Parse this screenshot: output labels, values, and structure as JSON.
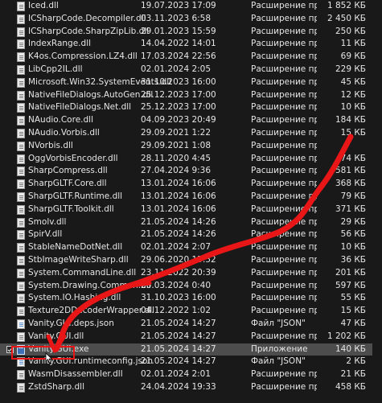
{
  "files": [
    {
      "name": "Iced.dll",
      "date": "19.07.2023 17:09",
      "type": "Расширение при...",
      "size": "1 852 КБ",
      "icon": "dll"
    },
    {
      "name": "ICSharpCode.Decompiler.dll",
      "date": "03.11.2023 6:58",
      "type": "Расширение при...",
      "size": "2 450 КБ",
      "icon": "dll"
    },
    {
      "name": "ICSharpCode.SharpZipLib.dll",
      "date": "29.01.2023 15:59",
      "type": "Расширение при...",
      "size": "250 КБ",
      "icon": "dll"
    },
    {
      "name": "IndexRange.dll",
      "date": "14.04.2022 14:01",
      "type": "Расширение при...",
      "size": "11 КБ",
      "icon": "dll"
    },
    {
      "name": "K4os.Compression.LZ4.dll",
      "date": "17.03.2024 22:56",
      "type": "Расширение при...",
      "size": "69 КБ",
      "icon": "dll"
    },
    {
      "name": "LibCpp2IL.dll",
      "date": "02.01.2024 2:05",
      "type": "Расширение при...",
      "size": "229 КБ",
      "icon": "dll"
    },
    {
      "name": "Microsoft.Win32.SystemEvents.dll",
      "date": "31.10.2023 16:00",
      "type": "Расширение при...",
      "size": "45 КБ",
      "icon": "dll"
    },
    {
      "name": "NativeFileDialogs.AutoGen.dll",
      "date": "25.12.2023 17:00",
      "type": "Расширение при...",
      "size": "12 КБ",
      "icon": "dll"
    },
    {
      "name": "NativeFileDialogs.Net.dll",
      "date": "25.12.2023 17:00",
      "type": "Расширение при...",
      "size": "10 КБ",
      "icon": "dll"
    },
    {
      "name": "NAudio.Core.dll",
      "date": "04.09.2023 20:49",
      "type": "Расширение при...",
      "size": "184 КБ",
      "icon": "dll"
    },
    {
      "name": "NAudio.Vorbis.dll",
      "date": "29.09.2021 1:22",
      "type": "Расширение при...",
      "size": "15 КБ",
      "icon": "dll"
    },
    {
      "name": "NVorbis.dll",
      "date": "29.09.2021 1:08",
      "type": "Расширение при...",
      "size": "",
      "icon": "dll"
    },
    {
      "name": "OggVorbisEncoder.dll",
      "date": "28.11.2020 4:45",
      "type": "Расширение при...",
      "size": "74 КБ",
      "icon": "dll"
    },
    {
      "name": "SharpCompress.dll",
      "date": "27.04.2024 9:36",
      "type": "Расширение при...",
      "size": "581 КБ",
      "icon": "dll"
    },
    {
      "name": "SharpGLTF.Core.dll",
      "date": "13.01.2024 16:06",
      "type": "Расширение при...",
      "size": "368 КБ",
      "icon": "dll"
    },
    {
      "name": "SharpGLTF.Runtime.dll",
      "date": "13.01.2024 16:06",
      "type": "Расширение при...",
      "size": "79 КБ",
      "icon": "dll"
    },
    {
      "name": "SharpGLTF.Toolkit.dll",
      "date": "13.01.2024 16:06",
      "type": "Расширение при...",
      "size": "371 КБ",
      "icon": "dll"
    },
    {
      "name": "Smolv.dll",
      "date": "21.05.2024 14:26",
      "type": "Расширение при...",
      "size": "29 КБ",
      "icon": "dll"
    },
    {
      "name": "SpirV.dll",
      "date": "21.05.2024 14:26",
      "type": "Расширение при...",
      "size": "56 КБ",
      "icon": "dll"
    },
    {
      "name": "StableNameDotNet.dll",
      "date": "02.01.2024 2:07",
      "type": "Расширение при...",
      "size": "10 КБ",
      "icon": "dll"
    },
    {
      "name": "StbImageWriteSharp.dll",
      "date": "29.06.2020 15:52",
      "type": "Расширение при...",
      "size": "36 КБ",
      "icon": "dll"
    },
    {
      "name": "System.CommandLine.dll",
      "date": "23.11.2022 20:39",
      "type": "Расширение при...",
      "size": "201 КБ",
      "icon": "dll"
    },
    {
      "name": "System.Drawing.Common.dll",
      "date": "20.03.2024 0:40",
      "type": "Расширение при...",
      "size": "597 КБ",
      "icon": "dll"
    },
    {
      "name": "System.IO.Hashing.dll",
      "date": "31.10.2023 16:00",
      "type": "Расширение при...",
      "size": "55 КБ",
      "icon": "dll"
    },
    {
      "name": "Texture2DDecoderWrapper.dll",
      "date": "04.12.2022 1:02",
      "type": "Расширение при...",
      "size": "15 КБ",
      "icon": "dll"
    },
    {
      "name": "Vanity.GUI.deps.json",
      "date": "21.05.2024 14:27",
      "type": "Файл \"JSON\"",
      "size": "47 КБ",
      "icon": "json"
    },
    {
      "name": "Vanity.GUI.dll",
      "date": "21.05.2024 14:27",
      "type": "Расширение при...",
      "size": "1 202 КБ",
      "icon": "dll"
    },
    {
      "name": "Vanity.GUI.exe",
      "date": "21.05.2024 14:27",
      "type": "Приложение",
      "size": "140 КБ",
      "icon": "exe",
      "selected": true
    },
    {
      "name": "Vanity.GUI.runtimeconfig.json",
      "date": "21.05.2024 14:27",
      "type": "Файл \"JSON\"",
      "size": "2 КБ",
      "icon": "json"
    },
    {
      "name": "WasmDisassembler.dll",
      "date": "02.01.2024 2:01",
      "type": "Расширение при...",
      "size": "21 КБ",
      "icon": "dll"
    },
    {
      "name": "ZstdSharp.dll",
      "date": "24.04.2024 19:33",
      "type": "Расширение при...",
      "size": "458 КБ",
      "icon": "dll"
    }
  ],
  "colors": {
    "background": "#191919",
    "selected_row": "#4d4d4d",
    "text": "#e6e6e6",
    "annotation_red": "#e81616"
  },
  "annotation": {
    "arrow_color": "#e81616",
    "highlight_target": "Vanity.GUI.exe"
  }
}
